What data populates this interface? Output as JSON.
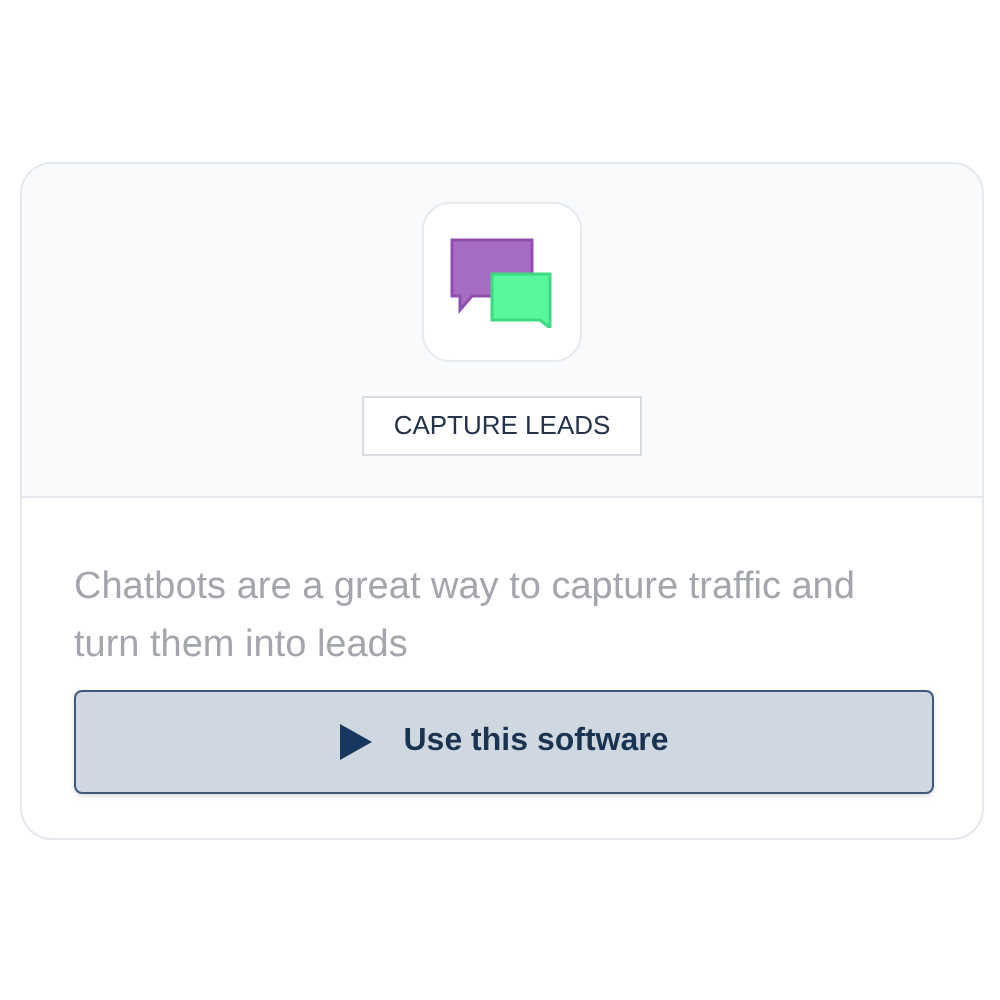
{
  "card": {
    "tag": "CAPTURE LEADS",
    "description": "Chatbots are a great way to capture traffic and turn them into leads",
    "button": {
      "label": "Use this software"
    }
  }
}
